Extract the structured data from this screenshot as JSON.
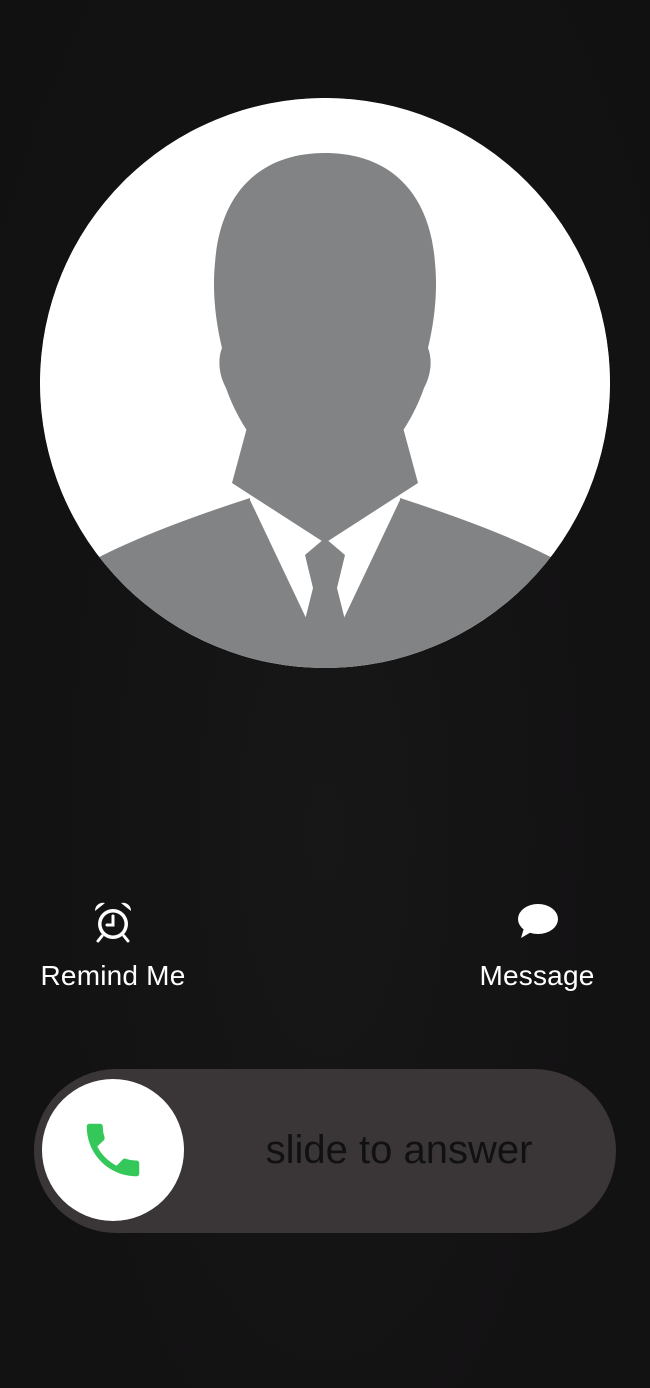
{
  "caller": {
    "avatar_icon": "person-silhouette-icon"
  },
  "actions": {
    "remind": {
      "label": "Remind Me",
      "icon": "alarm-clock-icon"
    },
    "message": {
      "label": "Message",
      "icon": "speech-bubble-icon"
    }
  },
  "answer_slider": {
    "label": "slide to answer",
    "icon": "phone-icon",
    "icon_color": "#34c759"
  },
  "colors": {
    "background": "#141314",
    "slider_track": "#3a3637",
    "avatar_bg": "#ffffff",
    "silhouette": "#818385"
  }
}
